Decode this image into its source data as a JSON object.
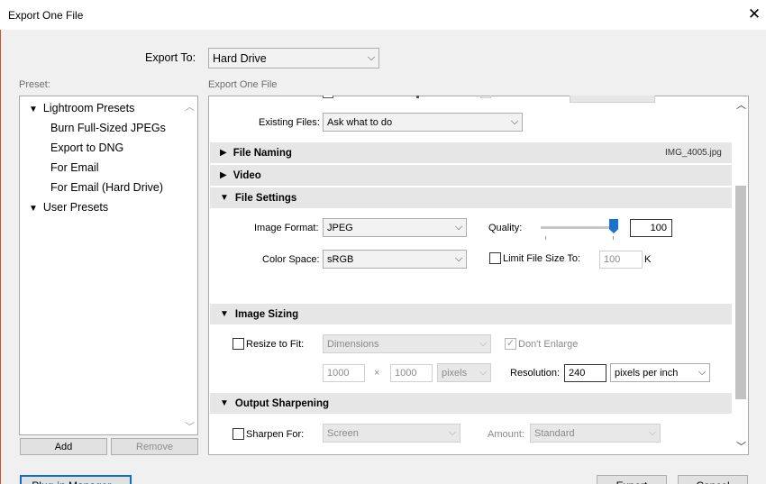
{
  "window": {
    "title": "Export One File",
    "close_glyph": "✕"
  },
  "export_to": {
    "label": "Export To:",
    "value": "Hard Drive"
  },
  "preset": {
    "label": "Preset:",
    "groups": [
      {
        "label": "Lightroom Presets",
        "items": [
          "Burn Full-Sized JPEGs",
          "Export to DNG",
          "For Email",
          "For Email (Hard Drive)"
        ]
      },
      {
        "label": "User Presets",
        "items": []
      }
    ],
    "add_label": "Add",
    "remove_label": "Remove"
  },
  "content_label": "Export One File",
  "existing_files": {
    "label": "Existing Files:",
    "value": "Ask what to do"
  },
  "sections": {
    "file_naming": {
      "label": "File Naming",
      "summary": "IMG_4005.jpg"
    },
    "video": {
      "label": "Video"
    },
    "file_settings": {
      "label": "File Settings"
    },
    "image_sizing": {
      "label": "Image Sizing"
    },
    "output_sharpening": {
      "label": "Output Sharpening"
    }
  },
  "file_settings": {
    "image_format_label": "Image Format:",
    "image_format": "JPEG",
    "quality_label": "Quality:",
    "quality": "100",
    "quality_fraction": 1.0,
    "color_space_label": "Color Space:",
    "color_space": "sRGB",
    "limit_label": "Limit File Size To:",
    "limit_value": "100",
    "limit_unit": "K"
  },
  "image_sizing": {
    "resize_label": "Resize to Fit:",
    "resize_mode": "Dimensions",
    "dont_enlarge_label": "Don't Enlarge",
    "width": "1000",
    "times": "×",
    "height": "1000",
    "unit": "pixels",
    "resolution_label": "Resolution:",
    "resolution": "240",
    "resolution_unit": "pixels per inch"
  },
  "output_sharpening": {
    "sharpen_label": "Sharpen For:",
    "sharpen_value": "Screen",
    "amount_label": "Amount:",
    "amount_value": "Standard"
  },
  "footer": {
    "plugin_manager": "Plug-in Manager...",
    "export": "Export",
    "cancel": "Cancel"
  }
}
